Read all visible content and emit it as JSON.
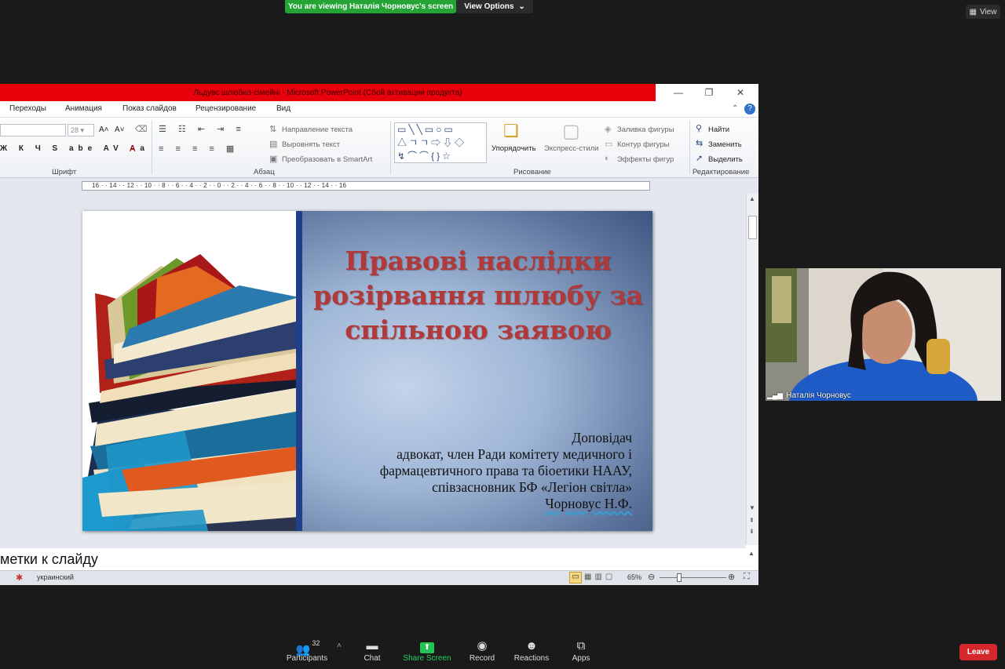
{
  "zoom": {
    "banner": "You are viewing Наталія Чорновус's screen",
    "view_options": "View Options",
    "view": "View",
    "participant_name": "Наталія Чорновус",
    "toolbar": {
      "participants": "Participants",
      "participants_count": "32",
      "chat": "Chat",
      "share_screen": "Share Screen",
      "record": "Record",
      "reactions": "Reactions",
      "apps": "Apps",
      "leave": "Leave"
    }
  },
  "ppt": {
    "window_title": "Льдувс шлюбно-сімейні  -  Microsoft PowerPoint (Сбой активации продукта)",
    "menu": [
      "Переходы",
      "Анимация",
      "Показ слайдов",
      "Рецензирование",
      "Вид"
    ],
    "ribbon": {
      "font_size": "28",
      "group_font": "Шрифт",
      "group_paragraph": "Абзац",
      "group_drawing": "Рисование",
      "group_editing": "Редактирование",
      "text_direction": "Направление текста",
      "align_text": "Выровнять текст",
      "smartart": "Преобразовать в SmartArt",
      "arrange": "Упорядочить",
      "quick_styles": "Экспресс-стили",
      "shape_fill": "Заливка фигуры",
      "shape_outline": "Контур фигуры",
      "shape_effects": "Эффекты фигур",
      "find": "Найти",
      "replace": "Заменить",
      "select": "Выделить"
    },
    "ruler_text": "16 · · 14 · · 12 · · 10 · · 8 · · 6 · · 4 · · 2 · · 0 · · 2 · · 4 · · 6 · · 8 · · 10 · · 12 · · 14 · · 16",
    "slide": {
      "title": "Правові наслідки розірвання шлюбу за спільною заявою",
      "presenter_label": "Доповідач",
      "presenter_line1": "адвокат, член Ради комітету медичного і",
      "presenter_line2": "фармацевтичного права та біоетики НААУ,",
      "presenter_line3": "співзасновник БФ «Легіон світла»",
      "presenter_name": "Чорновус Н.Ф."
    },
    "notes_placeholder": "метки к слайду",
    "status": {
      "language": "украинский",
      "zoom": "65%"
    }
  }
}
